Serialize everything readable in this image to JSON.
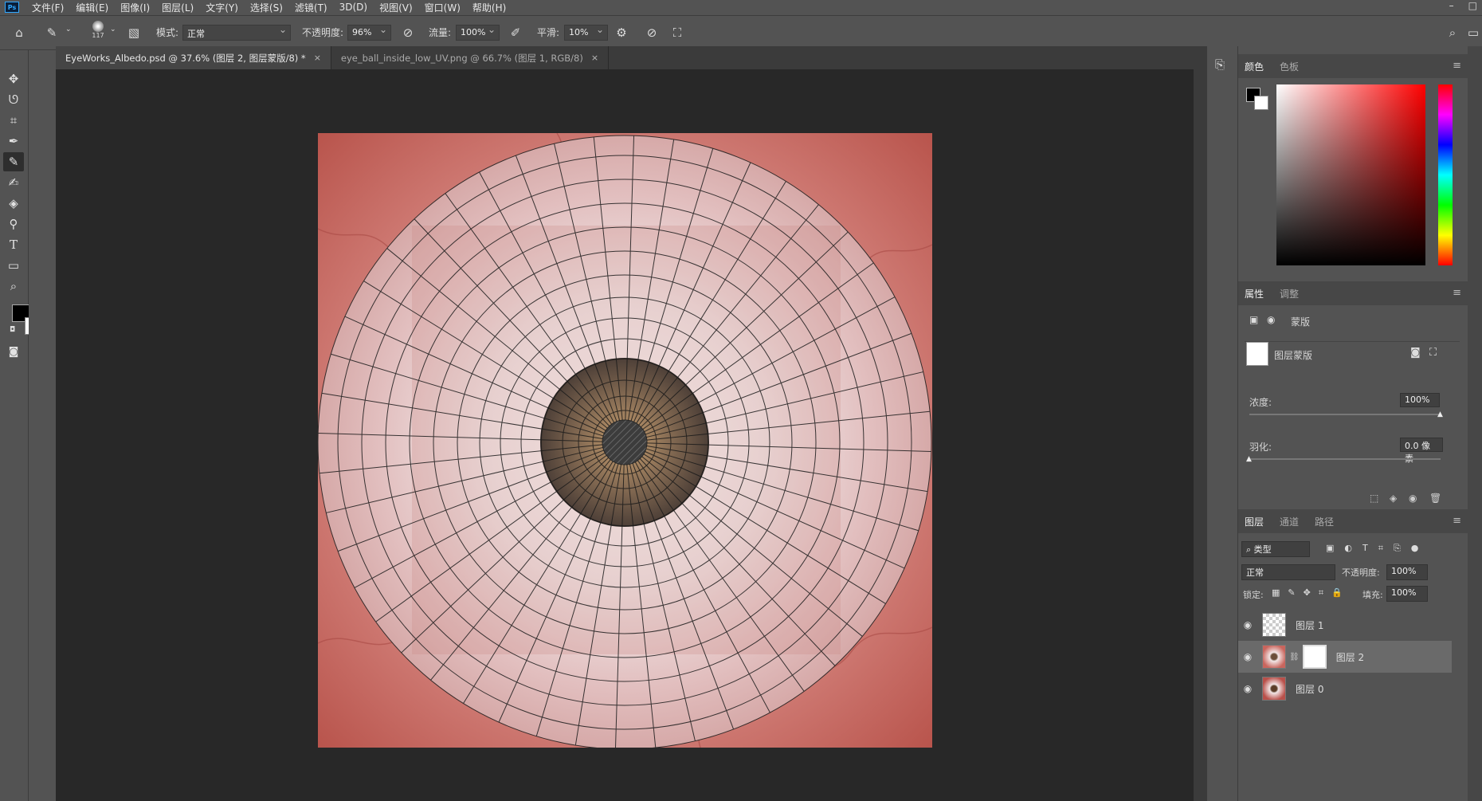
{
  "menubar": {
    "logo": "Ps",
    "items": [
      "文件(F)",
      "编辑(E)",
      "图像(I)",
      "图层(L)",
      "文字(Y)",
      "选择(S)",
      "滤镜(T)",
      "3D(D)",
      "视图(V)",
      "窗口(W)",
      "帮助(H)"
    ],
    "min": "–",
    "restore": "□"
  },
  "options": {
    "brush_size": "117",
    "mode_label": "模式:",
    "mode_value": "正常",
    "opacity_label": "不透明度:",
    "opacity_value": "96%",
    "flow_label": "流量:",
    "flow_value": "100%",
    "smooth_label": "平滑:",
    "smooth_value": "10%"
  },
  "tabs": [
    {
      "label": "EyeWorks_Albedo.psd @ 37.6% (图层 2, 图层蒙版/8) *",
      "close": "×"
    },
    {
      "label": "eye_ball_inside_low_UV.png @ 66.7% (图层 1, RGB/8)",
      "close": "×"
    }
  ],
  "color_panel": {
    "tabs": [
      "颜色",
      "色板"
    ],
    "menu": "≡"
  },
  "properties_panel": {
    "tabs": [
      "属性",
      "调整"
    ],
    "mask_title": "蒙版",
    "layer_mask_label": "图层蒙版",
    "density_label": "浓度:",
    "density_value": "100%",
    "feather_label": "羽化:",
    "feather_value": "0.0 像素"
  },
  "layers_panel": {
    "tabs": [
      "图层",
      "通道",
      "路径"
    ],
    "filter_kind": "类型",
    "blend_mode": "正常",
    "opacity_label": "不透明度:",
    "opacity_value": "100%",
    "lock_label": "锁定:",
    "fill_label": "填充:",
    "fill_value": "100%",
    "layers": [
      {
        "name": "图层 1"
      },
      {
        "name": "图层 2"
      },
      {
        "name": "图层 0"
      }
    ]
  },
  "colors": {
    "accent": "#31a8ff",
    "panel": "#535353",
    "canvas_bg": "#282828",
    "sclera_red": "#c05a52",
    "iris": "#7a6554"
  }
}
